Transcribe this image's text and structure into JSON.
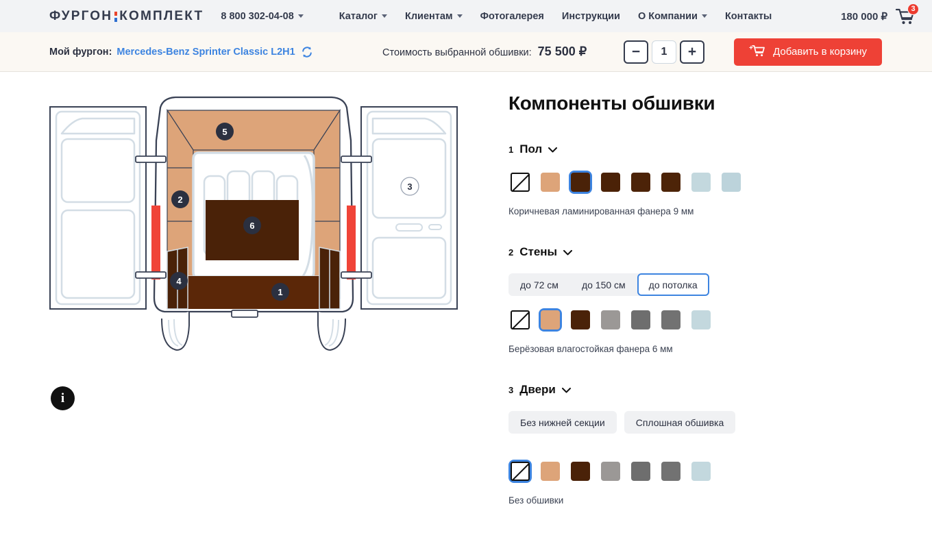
{
  "header": {
    "logo": {
      "part1": "ФУРГОН",
      "part2": "КОМПЛЕКТ",
      "colon_top_color": "#e8452c",
      "colon_bottom_color": "#2f6fd0"
    },
    "phone": "8 800 302-04-08",
    "nav": [
      {
        "label": "Каталог",
        "has_dropdown": true
      },
      {
        "label": "Клиентам",
        "has_dropdown": true
      },
      {
        "label": "Фотогалерея",
        "has_dropdown": false
      },
      {
        "label": "Инструкции",
        "has_dropdown": false
      },
      {
        "label": "О Компании",
        "has_dropdown": true
      },
      {
        "label": "Контакты",
        "has_dropdown": false
      }
    ],
    "cart_total": "180 000 ₽",
    "cart_badge": "3"
  },
  "toolbar": {
    "my_van_label": "Мой фургон:",
    "my_van_model": "Mercedes-Benz Sprinter Classic L2H1",
    "price_label": "Стоимость выбранной обшивки:",
    "price_value": "75 500 ₽",
    "qty_minus": "−",
    "qty_value": "1",
    "qty_plus": "+",
    "add_to_cart": "Добавить в корзину",
    "add_to_cart_color": "#ee4136"
  },
  "diagram": {
    "markers": [
      {
        "id": "1",
        "label": "1",
        "style": "dark"
      },
      {
        "id": "2",
        "label": "2",
        "style": "dark"
      },
      {
        "id": "3",
        "label": "3",
        "style": "light"
      },
      {
        "id": "4",
        "label": "4",
        "style": "dark"
      },
      {
        "id": "5",
        "label": "5",
        "style": "dark"
      },
      {
        "id": "6",
        "label": "6",
        "style": "dark"
      }
    ],
    "colors": {
      "wall": "#dda479",
      "ceiling": "#dda479",
      "floor": "#5b2708",
      "panel_red": "#f04438",
      "outline": "#3a4255",
      "body_line": "#d3dde5",
      "box": "#4a2208"
    },
    "info_icon": "i"
  },
  "panel": {
    "title": "Компоненты обшивки",
    "sections": [
      {
        "num": "1",
        "name": "Пол",
        "options": [],
        "swatches": [
          {
            "name": "none",
            "color": ""
          },
          {
            "name": "tan",
            "color": "#dda479"
          },
          {
            "name": "dark-brown",
            "color": "#4a2208"
          },
          {
            "name": "brown-2",
            "color": "#4b2207"
          },
          {
            "name": "brown-3",
            "color": "#4c2308"
          },
          {
            "name": "brown-4",
            "color": "#4d2408"
          },
          {
            "name": "light-blue",
            "color": "#c3d8de"
          },
          {
            "name": "light-blue-2",
            "color": "#bcd3db"
          }
        ],
        "selected_swatch": 2,
        "description": "Коричневая ламинированная фанера 9 мм"
      },
      {
        "num": "2",
        "name": "Стены",
        "options": [
          {
            "label": "до 72 см",
            "selected": false
          },
          {
            "label": "до 150 см",
            "selected": false
          },
          {
            "label": "до потолка",
            "selected": true
          }
        ],
        "options_grouped": true,
        "swatches": [
          {
            "name": "none",
            "color": ""
          },
          {
            "name": "tan",
            "color": "#dda479"
          },
          {
            "name": "dark-brown",
            "color": "#4a2208"
          },
          {
            "name": "gray-light",
            "color": "#9b9896"
          },
          {
            "name": "gray-mid",
            "color": "#6e6e6e"
          },
          {
            "name": "gray-mid-2",
            "color": "#727272"
          },
          {
            "name": "light-blue",
            "color": "#c3d8de"
          }
        ],
        "selected_swatch": 1,
        "description": "Берёзовая влагостойкая фанера 6 мм"
      },
      {
        "num": "3",
        "name": "Двери",
        "options": [
          {
            "label": "Без нижней секции",
            "selected": false
          },
          {
            "label": "Сплошная обшивка",
            "selected": false
          }
        ],
        "options_grouped": false,
        "swatches": [
          {
            "name": "none",
            "color": ""
          },
          {
            "name": "tan",
            "color": "#dda479"
          },
          {
            "name": "dark-brown",
            "color": "#4a2208"
          },
          {
            "name": "gray-light",
            "color": "#9b9896"
          },
          {
            "name": "gray-mid",
            "color": "#6e6e6e"
          },
          {
            "name": "gray-mid-2",
            "color": "#727272"
          },
          {
            "name": "light-blue",
            "color": "#c3d8de"
          }
        ],
        "selected_swatch": 0,
        "description": "Без обшивки"
      }
    ]
  }
}
